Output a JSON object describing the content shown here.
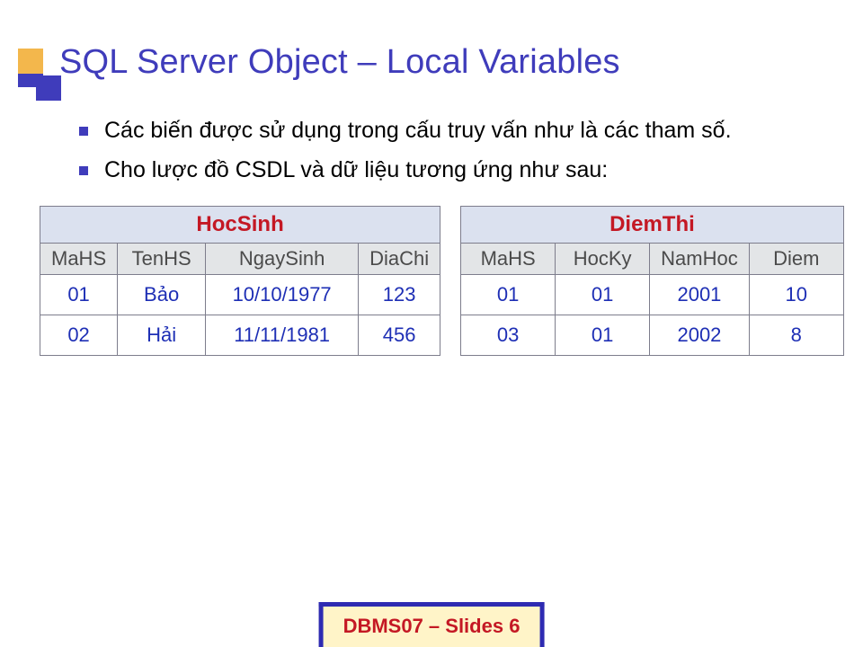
{
  "slide": {
    "title": "SQL Server Object – Local Variables"
  },
  "bullets": {
    "b0": "Các biến được sử dụng trong cấu truy vấn như là các tham số.",
    "b1": "Cho lược đồ CSDL và dữ liệu tương ứng như sau:"
  },
  "tables": {
    "hocsinh": {
      "name": "HocSinh",
      "cols": {
        "c0": "MaHS",
        "c1": "TenHS",
        "c2": "NgaySinh",
        "c3": "DiaChi"
      },
      "rows": {
        "r0": {
          "c0": "01",
          "c1": "Bảo",
          "c2": "10/10/1977",
          "c3": "123"
        },
        "r1": {
          "c0": "02",
          "c1": "Hải",
          "c2": "11/11/1981",
          "c3": "456"
        }
      }
    },
    "diemthi": {
      "name": "DiemThi",
      "cols": {
        "c0": "MaHS",
        "c1": "HocKy",
        "c2": "NamHoc",
        "c3": "Diem"
      },
      "rows": {
        "r0": {
          "c0": "01",
          "c1": "01",
          "c2": "2001",
          "c3": "10"
        },
        "r1": {
          "c0": "03",
          "c1": "01",
          "c2": "2002",
          "c3": "8"
        }
      }
    }
  },
  "footer": "DBMS07 – Slides 6"
}
